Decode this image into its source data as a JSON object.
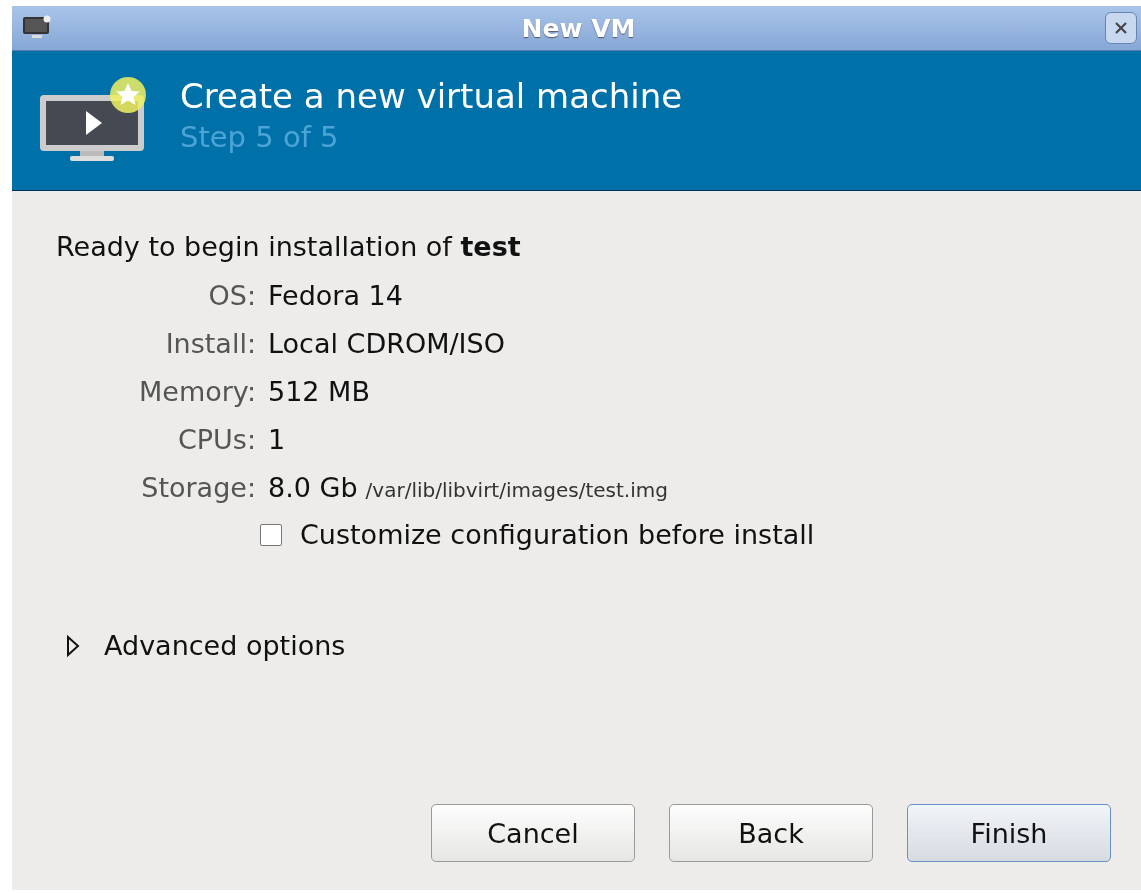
{
  "window": {
    "title": "New VM"
  },
  "header": {
    "title": "Create a new virtual machine",
    "subtitle": "Step 5 of 5"
  },
  "summary": {
    "heading": "Ready to begin installation of **test**",
    "details": [
      {
        "label": "OS:",
        "value": "Fedora 14"
      },
      {
        "label": "Install:",
        "value": "Local CDROM/ISO"
      },
      {
        "label": "Memory:",
        "value": "512 MB"
      },
      {
        "label": "CPUs:",
        "value": "1"
      },
      {
        "label": "Storage:",
        "value": "8.0 Gb",
        "note": "/var/lib/libvirt/images/test.img"
      }
    ]
  },
  "customize": {
    "label": "Customize configuration before install",
    "checked": false
  },
  "advanced": {
    "label": "Advanced options",
    "expanded": false
  },
  "buttons": [
    {
      "label": "Cancel",
      "default": false
    },
    {
      "label": "Back",
      "default": false
    },
    {
      "label": "Finish",
      "default": true
    }
  ]
}
